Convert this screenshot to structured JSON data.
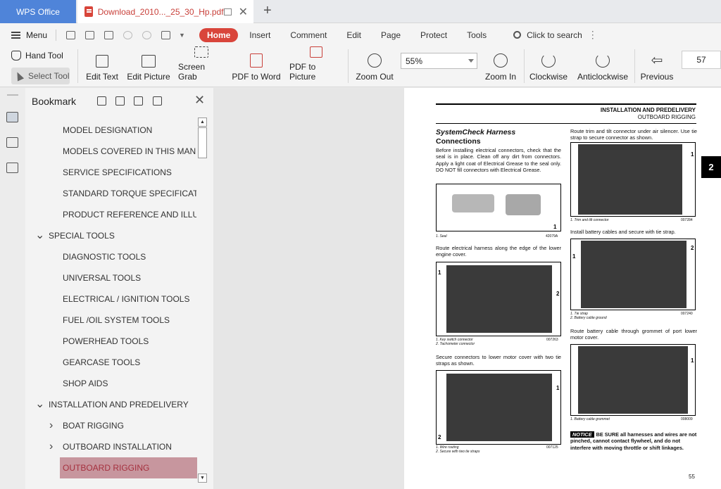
{
  "titlebar": {
    "app_tab": "WPS Office",
    "doc_tab": "Download_2010..._25_30_Hp.pdf"
  },
  "menu": {
    "menu_label": "Menu",
    "tabs": [
      "Home",
      "Insert",
      "Comment",
      "Edit",
      "Page",
      "Protect",
      "Tools"
    ],
    "search": "Click to search"
  },
  "toolbar": {
    "hand_tool": "Hand Tool",
    "select_tool": "Select Tool",
    "edit_text": "Edit Text",
    "edit_picture": "Edit Picture",
    "screen_grab": "Screen Grab",
    "pdf_to_word": "PDF to Word",
    "pdf_to_picture": "PDF to Picture",
    "zoom_out": "Zoom Out",
    "zoom_value": "55%",
    "zoom_in": "Zoom In",
    "clockwise": "Clockwise",
    "anticlockwise": "Anticlockwise",
    "previous": "Previous",
    "page_number": "57"
  },
  "bookmark": {
    "title": "Bookmark",
    "items": [
      {
        "label": "MODEL DESIGNATION",
        "level": 1
      },
      {
        "label": "MODELS COVERED IN THIS MANU...",
        "level": 1
      },
      {
        "label": "SERVICE SPECIFICATIONS",
        "level": 1
      },
      {
        "label": "STANDARD TORQUE SPECIFICATI...",
        "level": 1
      },
      {
        "label": "PRODUCT REFERENCE AND ILLUS...",
        "level": 1
      },
      {
        "label": "SPECIAL TOOLS",
        "level": 0,
        "expanded": true
      },
      {
        "label": "DIAGNOSTIC TOOLS",
        "level": 1
      },
      {
        "label": "UNIVERSAL TOOLS",
        "level": 1
      },
      {
        "label": "ELECTRICAL / IGNITION TOOLS",
        "level": 1
      },
      {
        "label": "FUEL /OIL SYSTEM TOOLS",
        "level": 1
      },
      {
        "label": "POWERHEAD TOOLS",
        "level": 1
      },
      {
        "label": "GEARCASE TOOLS",
        "level": 1
      },
      {
        "label": "SHOP AIDS",
        "level": 1
      },
      {
        "label": "INSTALLATION AND PREDELIVERY",
        "level": 0,
        "expanded": true
      },
      {
        "label": "BOAT RIGGING",
        "level": 1,
        "collapsed": true
      },
      {
        "label": "OUTBOARD INSTALLATION",
        "level": 1,
        "collapsed": true
      },
      {
        "label": "OUTBOARD RIGGING",
        "level": 1,
        "collapsed": true,
        "selected": true
      }
    ]
  },
  "page": {
    "header_title": "INSTALLATION AND PREDELIVERY",
    "header_sub": "OUTBOARD RIGGING",
    "section_tab": "2",
    "title_line1": "SystemCheck Harness",
    "title_line2": "Connections",
    "para1": "Before installing electrical connectors, check that the seal is in place. Clean off any dirt from connectors. Apply a light coat of Electrical Grease to the seal only. DO NOT fill connectors with Electrical Grease.",
    "fig1_cap": "1.   Seal",
    "fig1_code": "42079A",
    "para2": "Route electrical harness along the edge of the lower engine cover.",
    "fig2_cap1": "1.   Key switch connector",
    "fig2_cap2": "2.   Tachometer connector",
    "fig2_code": "007263",
    "para3": "Secure connectors to lower motor cover with two tie straps as shown.",
    "fig3_cap1": "1.   Wire routing",
    "fig3_cap2": "2.   Secure with two tie straps",
    "fig3_code": "007125",
    "para4": "Route trim and tilt connector under air silencer. Use tie strap to secure connector as shown.",
    "fig4_cap": "1.   Trim and tilt connector",
    "fig4_code": "007284",
    "para5": "Install battery cables and secure with tie strap.",
    "fig5_cap1": "1.   Tie strap",
    "fig5_cap2": "2.   Battery cable ground",
    "fig5_code": "007240",
    "para6": "Route battery cable through grommet of port lower motor cover.",
    "fig6_cap": "1.   Battery cable grommet",
    "fig6_code": "008009",
    "notice_label": "NOTICE",
    "notice_text": "BE SURE all harnesses and wires are not pinched, cannot contact flywheel, and do not interfere with moving throttle or shift linkages.",
    "page_num": "55",
    "callout_1": "1",
    "callout_2": "2"
  },
  "colors": {
    "accent": "#d9453b",
    "wps_blue": "#4f84d9",
    "selected_bookmark": "#c7969e"
  }
}
